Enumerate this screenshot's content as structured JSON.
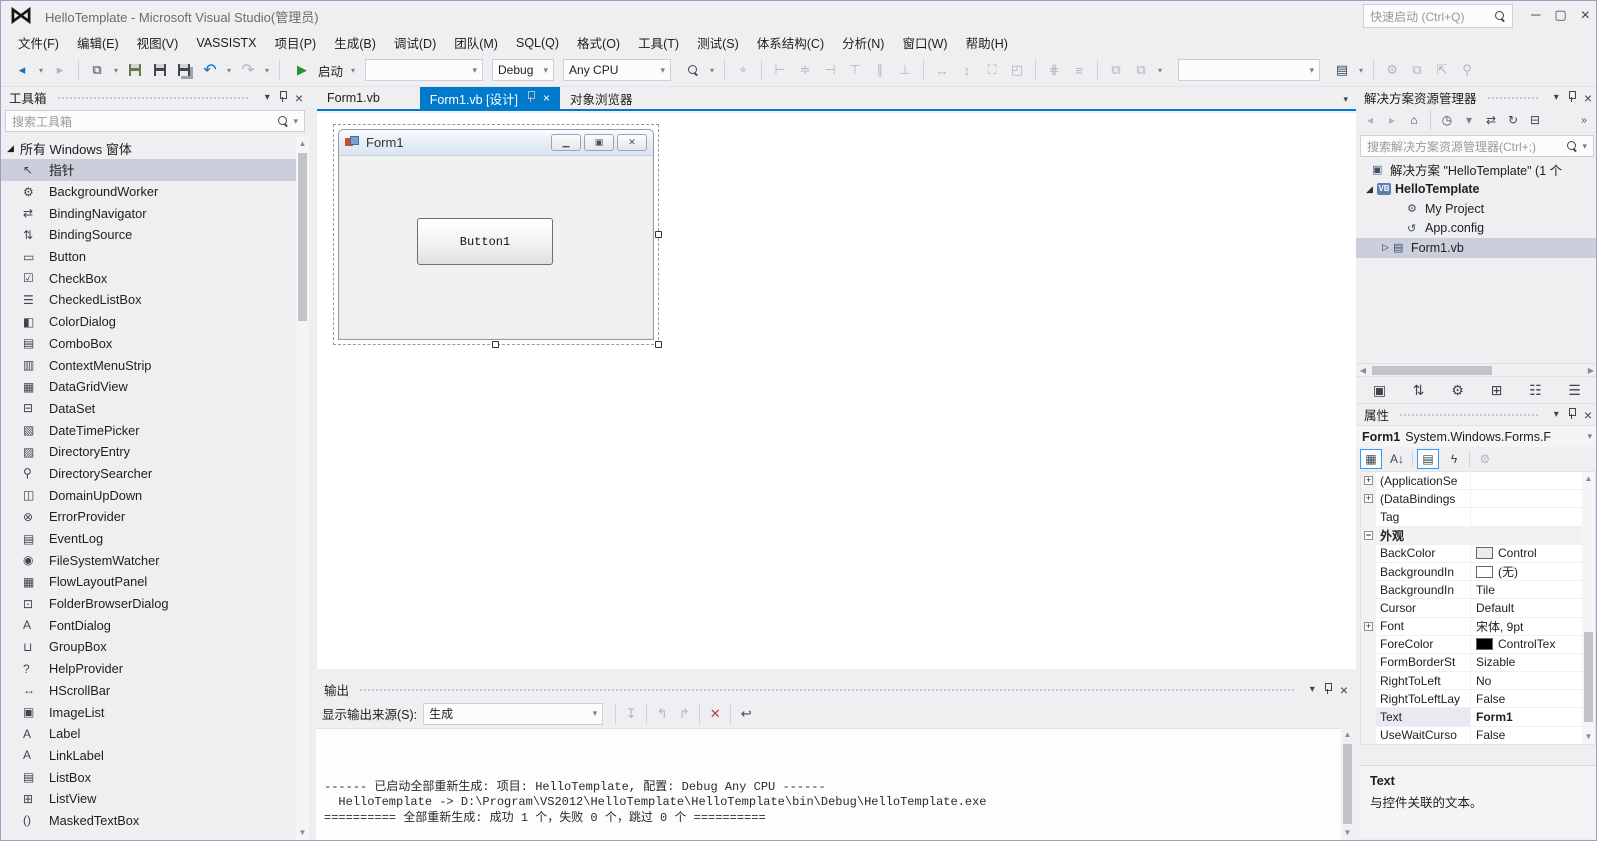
{
  "window": {
    "title": "HelloTemplate - Microsoft Visual Studio(管理员)",
    "quick_launch_placeholder": "快速启动 (Ctrl+Q)"
  },
  "icons": {
    "logo": "⋈",
    "minimize": "─",
    "restore": "▢",
    "close": "×",
    "nav_back": "◂",
    "nav_fwd": "▸",
    "caret": "▾",
    "new_file": "⧉",
    "undo": "↶",
    "redo": "↷",
    "start_play": "▶",
    "find": "⌕",
    "collapse_all": "⊟",
    "home": "⌂",
    "refresh": "↻",
    "sync": "⇄",
    "pending": "◷",
    "overflow": "»",
    "sort_az": "A↓",
    "events": "ϟ",
    "wrench": "⚙",
    "categorized": "▦",
    "prop_page": "▤",
    "clear": "✕",
    "wrap": "↩",
    "prev": "↰",
    "next": "↱",
    "msg": "↧",
    "expanded": "◢",
    "collapsed": "▷",
    "scroll_up": "▲",
    "scroll_dn": "▼",
    "scroll_l": "◀",
    "scroll_r": "▶"
  },
  "menu": {
    "items": [
      {
        "label": "文件(F)"
      },
      {
        "label": "编辑(E)"
      },
      {
        "label": "视图(V)"
      },
      {
        "label": "VASSISTX"
      },
      {
        "label": "项目(P)"
      },
      {
        "label": "生成(B)"
      },
      {
        "label": "调试(D)"
      },
      {
        "label": "团队(M)"
      },
      {
        "label": "SQL(Q)"
      },
      {
        "label": "格式(O)"
      },
      {
        "label": "工具(T)"
      },
      {
        "label": "测试(S)"
      },
      {
        "label": "体系结构(C)"
      },
      {
        "label": "分析(N)"
      },
      {
        "label": "窗口(W)"
      },
      {
        "label": "帮助(H)"
      }
    ]
  },
  "toolbar": {
    "start_label": "启动",
    "config_value": "Debug",
    "platform_value": "Any CPU",
    "profile_value": "",
    "zoom_value": ""
  },
  "toolbox": {
    "title": "工具箱",
    "search_placeholder": "搜索工具箱",
    "group_label": "所有 Windows 窗体",
    "items": [
      {
        "label": "指针",
        "glyph": "↖",
        "selected": true
      },
      {
        "label": "BackgroundWorker",
        "glyph": "⚙"
      },
      {
        "label": "BindingNavigator",
        "glyph": "⇄"
      },
      {
        "label": "BindingSource",
        "glyph": "⇅"
      },
      {
        "label": "Button",
        "glyph": "▭"
      },
      {
        "label": "CheckBox",
        "glyph": "☑"
      },
      {
        "label": "CheckedListBox",
        "glyph": "☰"
      },
      {
        "label": "ColorDialog",
        "glyph": "◧"
      },
      {
        "label": "ComboBox",
        "glyph": "▤"
      },
      {
        "label": "ContextMenuStrip",
        "glyph": "▥"
      },
      {
        "label": "DataGridView",
        "glyph": "▦"
      },
      {
        "label": "DataSet",
        "glyph": "⊟"
      },
      {
        "label": "DateTimePicker",
        "glyph": "▧"
      },
      {
        "label": "DirectoryEntry",
        "glyph": "▨"
      },
      {
        "label": "DirectorySearcher",
        "glyph": "⚲"
      },
      {
        "label": "DomainUpDown",
        "glyph": "◫"
      },
      {
        "label": "ErrorProvider",
        "glyph": "⊗"
      },
      {
        "label": "EventLog",
        "glyph": "▤"
      },
      {
        "label": "FileSystemWatcher",
        "glyph": "◉"
      },
      {
        "label": "FlowLayoutPanel",
        "glyph": "▦"
      },
      {
        "label": "FolderBrowserDialog",
        "glyph": "⊡"
      },
      {
        "label": "FontDialog",
        "glyph": "A"
      },
      {
        "label": "GroupBox",
        "glyph": "⊔"
      },
      {
        "label": "HelpProvider",
        "glyph": "?"
      },
      {
        "label": "HScrollBar",
        "glyph": "↔"
      },
      {
        "label": "ImageList",
        "glyph": "▣"
      },
      {
        "label": "Label",
        "glyph": "A"
      },
      {
        "label": "LinkLabel",
        "glyph": "A"
      },
      {
        "label": "ListBox",
        "glyph": "▤"
      },
      {
        "label": "ListView",
        "glyph": "⊞"
      },
      {
        "label": "MaskedTextBox",
        "glyph": "()"
      }
    ]
  },
  "editor": {
    "tabs": [
      {
        "label": "Form1.vb",
        "active": false
      },
      {
        "label": "Form1.vb [设计]",
        "active": true
      },
      {
        "label": "对象浏览器",
        "active": false
      }
    ]
  },
  "designer": {
    "form_title": "Form1",
    "button_label": "Button1"
  },
  "output": {
    "title": "输出",
    "source_label": "显示输出来源(S):",
    "source_value": "生成",
    "lines": [
      {
        "text": "------ 已启动全部重新生成: 项目: HelloTemplate, 配置: Debug Any CPU ------"
      },
      {
        "text": "  HelloTemplate -> D:\\Program\\VS2012\\HelloTemplate\\HelloTemplate\\bin\\Debug\\HelloTemplate.exe"
      },
      {
        "text": "========== 全部重新生成: 成功 1 个，失败 0 个，跳过 0 个 =========="
      }
    ]
  },
  "solution_explorer": {
    "title": "解决方案资源管理器",
    "search_placeholder": "搜索解决方案资源管理器(Ctrl+;)",
    "tree": [
      {
        "label": "解决方案 \"HelloTemplate\" (1 个",
        "glyph": "▣",
        "exp": "",
        "pad": "5px"
      },
      {
        "label": "HelloTemplate",
        "glyph": "VB",
        "exp": "◢",
        "pad": "10px",
        "bold": true,
        "badge": true
      },
      {
        "label": "My Project",
        "glyph": "⚙",
        "exp": "",
        "pad": "40px"
      },
      {
        "label": "App.config",
        "glyph": "↺",
        "exp": "",
        "pad": "40px"
      },
      {
        "label": "Form1.vb",
        "glyph": "▤",
        "exp": "▷",
        "pad": "26px",
        "selected": true
      }
    ]
  },
  "properties": {
    "title": "属性",
    "object_name": "Form1",
    "object_type": "System.Windows.Forms.F",
    "rows": [
      {
        "name": "(ApplicationSe",
        "value": "",
        "exp": "+"
      },
      {
        "name": "(DataBindings",
        "value": "",
        "exp": "+"
      },
      {
        "name": "Tag",
        "value": ""
      },
      {
        "name": "外观",
        "value": "",
        "exp": "−",
        "category": true
      },
      {
        "name": "BackColor",
        "value": "Control",
        "swatch": "#ececec"
      },
      {
        "name": "BackgroundIn",
        "value": "(无)",
        "swatch": "#ffffff"
      },
      {
        "name": "BackgroundIn",
        "value": "Tile"
      },
      {
        "name": "Cursor",
        "value": "Default"
      },
      {
        "name": "Font",
        "value": "宋体, 9pt",
        "exp": "+"
      },
      {
        "name": "ForeColor",
        "value": "ControlTex",
        "swatch": "#000000"
      },
      {
        "name": "FormBorderSt",
        "value": "Sizable"
      },
      {
        "name": "RightToLeft",
        "value": "No"
      },
      {
        "name": "RightToLeftLay",
        "value": "False"
      },
      {
        "name": "Text",
        "value": "Form1",
        "bold": true,
        "selected": true
      },
      {
        "name": "UseWaitCurso",
        "value": "False"
      }
    ],
    "description_title": "Text",
    "description_text": "与控件关联的文本。"
  }
}
